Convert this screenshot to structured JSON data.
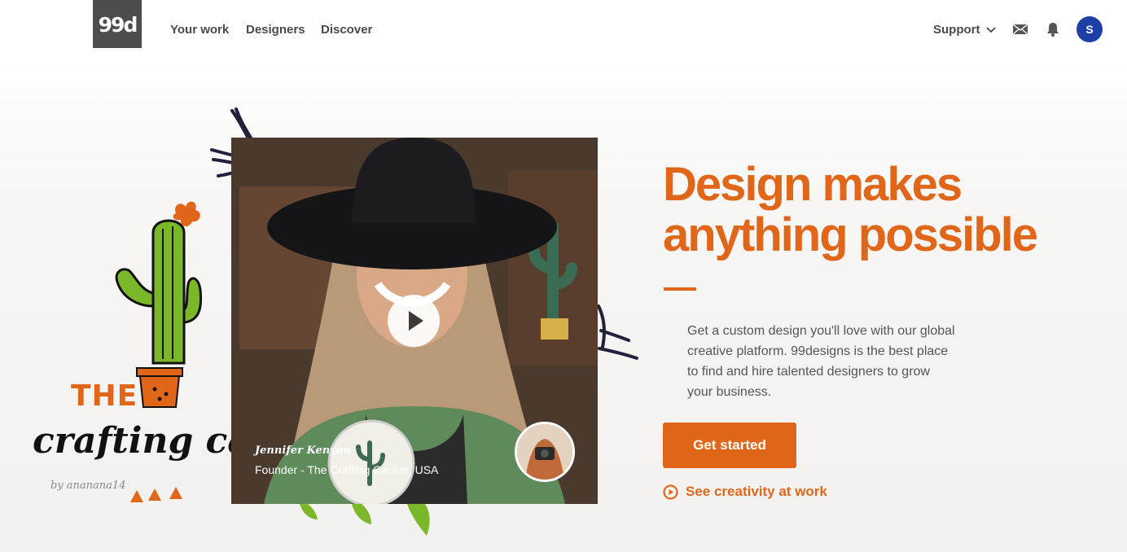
{
  "header": {
    "logo_text": "99d",
    "nav": [
      "Your work",
      "Designers",
      "Discover"
    ],
    "support_label": "Support",
    "avatar_initial": "S"
  },
  "hero": {
    "illustration": {
      "brand_word_1": "THE",
      "brand_word_2": "crafting cac",
      "credit": "by ananana14"
    },
    "video": {
      "person_name": "Jennifer Kenyon",
      "person_role": "Founder - The Crafting Cactus, USA",
      "badge_text": "the crafting cactus"
    },
    "headline": "Design makes anything possible",
    "description": "Get a custom design you'll love with our global creative platform. 99designs is the best place to find and hire talented designers to grow your business.",
    "cta_label": "Get started",
    "secondary_link": "See creativity at work"
  },
  "colors": {
    "accent": "#e0661a",
    "logo_bg": "#4d4d4d",
    "avatar_bg": "#1e3fa8"
  },
  "icons": [
    "mail-icon",
    "bell-icon",
    "chevron-down-icon",
    "play-icon",
    "play-circle-icon"
  ]
}
